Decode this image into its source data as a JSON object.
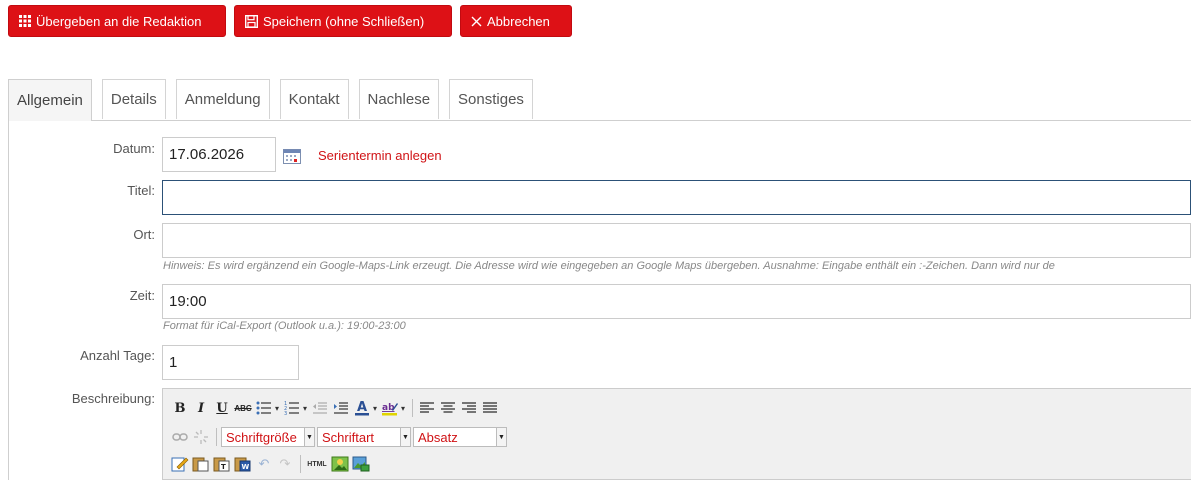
{
  "toolbar": {
    "submit_label": "Übergeben an die Redaktion",
    "save_label": "Speichern (ohne Schließen)",
    "cancel_label": "Abbrechen",
    "accent_color": "#dd1116"
  },
  "tabs": [
    {
      "label": "Allgemein",
      "active": true
    },
    {
      "label": "Details"
    },
    {
      "label": "Anmeldung"
    },
    {
      "label": "Kontakt"
    },
    {
      "label": "Nachlese"
    },
    {
      "label": "Sonstiges"
    }
  ],
  "form": {
    "datum": {
      "label": "Datum:",
      "value": "17.06.2026",
      "series_link": "Serientermin anlegen"
    },
    "titel": {
      "label": "Titel:",
      "value": ""
    },
    "ort": {
      "label": "Ort:",
      "value": "",
      "hint": "Hinweis: Es wird ergänzend ein Google-Maps-Link erzeugt. Die Adresse wird wie eingegeben an Google Maps übergeben. Ausnahme: Eingabe enthält ein :-Zeichen. Dann wird nur de"
    },
    "zeit": {
      "label": "Zeit:",
      "value": "19:00",
      "hint": "Format für iCal-Export (Outlook u.a.): 19:00-23:00"
    },
    "anzahl_tage": {
      "label": "Anzahl Tage:",
      "value": "1"
    },
    "beschreibung": {
      "label": "Beschreibung:"
    }
  },
  "editor": {
    "font_size": "Schriftgröße",
    "font_family": "Schriftart",
    "format": "Absatz",
    "html_label": "HTML"
  }
}
